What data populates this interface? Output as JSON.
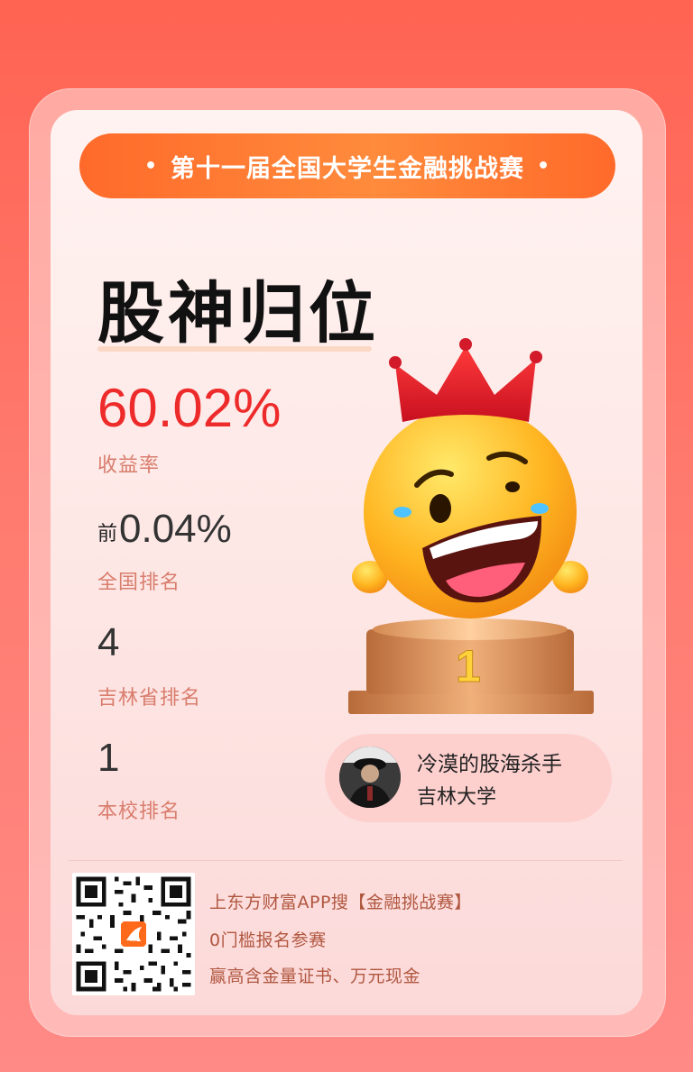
{
  "banner": {
    "title": "第十一届全国大学生金融挑战赛",
    "dot": "•"
  },
  "hero": {
    "title": "股神归位"
  },
  "stats": {
    "yield_value": "60.02%",
    "yield_label": "收益率",
    "national_rank_prefix": "前",
    "national_rank_value": "0.04%",
    "national_rank_label": "全国排名",
    "province_rank_value": "4",
    "province_rank_label": "吉林省排名",
    "school_rank_value": "1",
    "school_rank_label": "本校排名"
  },
  "user": {
    "name": "冷漠的股海杀手",
    "school": "吉林大学"
  },
  "mascot": {
    "podium_number": "1",
    "icon": "crowned-smiley-on-podium-icon"
  },
  "promo": {
    "line1": "上东方财富APP搜【金融挑战赛】",
    "line2": "0门槛报名参赛",
    "line3": "赢高含金量证书、万元现金"
  },
  "colors": {
    "background": "#ff6352",
    "banner": "#ff7a35",
    "accent_red": "#ee2b2b",
    "label": "#d97d6d",
    "promo_text": "#b0573f",
    "user_pill": "#fdd0ce"
  }
}
